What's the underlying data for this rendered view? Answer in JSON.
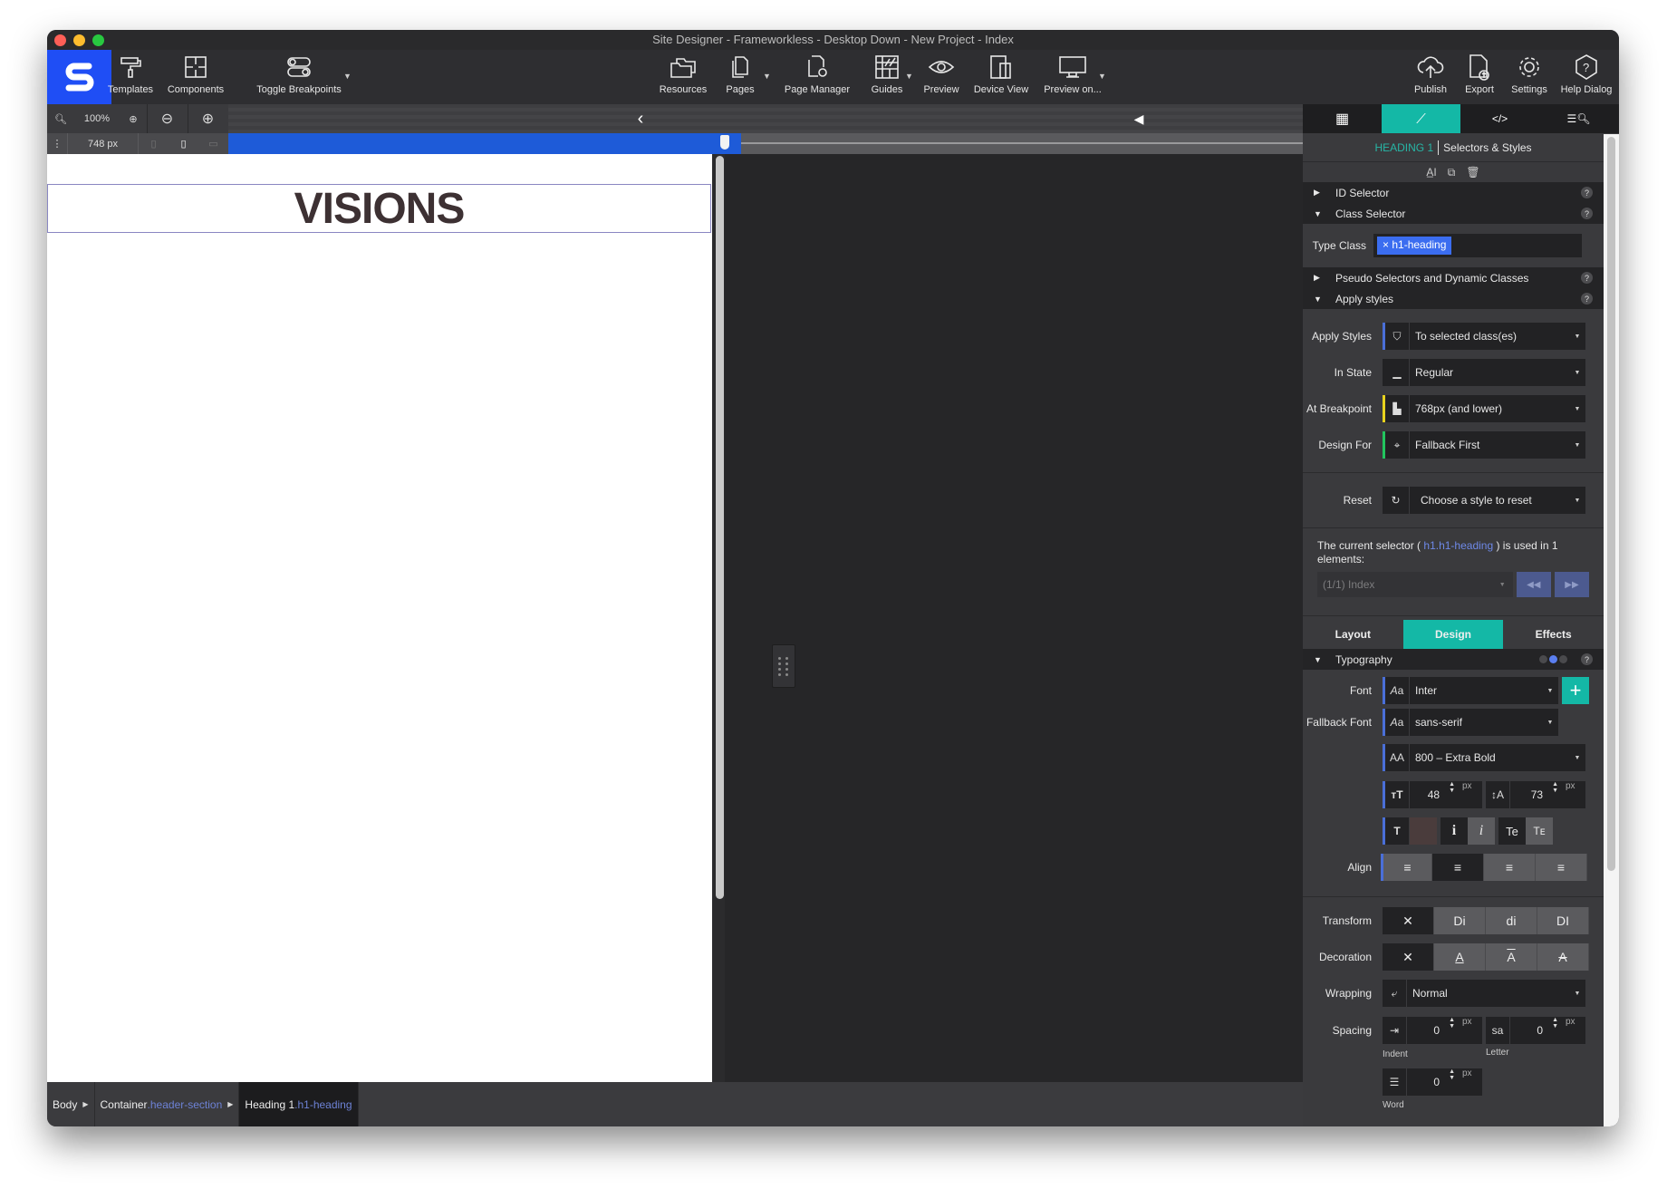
{
  "window": {
    "title": "Site Designer - Frameworkless - Desktop Down - New Project - Index"
  },
  "toolbar": {
    "left": [
      {
        "label": "Templates",
        "icon": "paint-roller-icon"
      },
      {
        "label": "Components",
        "icon": "puzzle-icon"
      },
      {
        "label": "Toggle Breakpoints",
        "icon": "toggle-icon"
      }
    ],
    "center": [
      {
        "label": "Resources",
        "icon": "folders-icon"
      },
      {
        "label": "Pages",
        "icon": "pages-icon"
      },
      {
        "label": "Page Manager",
        "icon": "page-manager-icon"
      },
      {
        "label": "Guides",
        "icon": "guides-icon"
      },
      {
        "label": "Preview",
        "icon": "eye-icon"
      },
      {
        "label": "Device View",
        "icon": "devices-icon"
      },
      {
        "label": "Preview on...",
        "icon": "monitor-icon"
      }
    ],
    "right": [
      {
        "label": "Publish",
        "icon": "cloud-upload-icon"
      },
      {
        "label": "Export",
        "icon": "export-icon"
      },
      {
        "label": "Settings",
        "icon": "gear-icon"
      },
      {
        "label": "Help Dialog",
        "icon": "help-icon"
      }
    ]
  },
  "canvas_controls": {
    "zoom": "100%",
    "width": "748 px",
    "breakpoint_position_pct": 68
  },
  "canvas": {
    "heading": "VISIONS",
    "heading_color": "#3d3133"
  },
  "breadcrumb": [
    {
      "name": "Body",
      "cls": ""
    },
    {
      "name": "Container",
      "cls": ".header-section"
    },
    {
      "name": "Heading 1",
      "cls": ".h1-heading"
    }
  ],
  "panel": {
    "element_type": "HEADING 1",
    "title": "Selectors & Styles",
    "sections": {
      "id_selector": "ID Selector",
      "class_selector": "Class Selector",
      "pseudo": "Pseudo Selectors and Dynamic Classes",
      "apply_styles": "Apply styles",
      "typography": "Typography"
    },
    "type_class_label": "Type Class",
    "type_class_tag": "h1-heading",
    "apply": {
      "apply_styles": {
        "label": "Apply Styles",
        "value": "To selected class(es)",
        "color": "#4a6fd8"
      },
      "in_state": {
        "label": "In State",
        "value": "Regular"
      },
      "at_breakpoint": {
        "label": "At Breakpoint",
        "value": "768px (and lower)",
        "color": "#e8d21e"
      },
      "design_for": {
        "label": "Design For",
        "value": "Fallback First",
        "color": "#22c55e"
      },
      "reset": {
        "label": "Reset",
        "value": "Choose a style to reset"
      }
    },
    "info": {
      "prefix": "The current selector (",
      "selector": "h1.h1-heading",
      "suffix": ") is used in 1 elements:",
      "page_select": "(1/1) Index"
    },
    "tabs": {
      "layout": "Layout",
      "design": "Design",
      "effects": "Effects"
    },
    "typography": {
      "font": {
        "label": "Font",
        "value": "Inter"
      },
      "fallback": {
        "label": "Fallback Font",
        "value": "sans-serif"
      },
      "weight": "800 – Extra Bold",
      "size": "48",
      "size_unit": "px",
      "line_height": "73",
      "line_unit": "px",
      "color": "#4a3c3c",
      "align_label": "Align",
      "transform_label": "Transform",
      "transform_options": [
        "Di",
        "di",
        "DI"
      ],
      "decoration_label": "Decoration",
      "wrapping_label": "Wrapping",
      "wrapping_value": "Normal",
      "spacing_label": "Spacing",
      "indent": "0",
      "indent_label": "Indent",
      "letter": "0",
      "letter_label": "Letter",
      "word": "0",
      "word_label": "Word",
      "unit": "px"
    }
  },
  "colors": {
    "accent": "#14b8a6",
    "brand": "#1f4ef5",
    "selection": "#1e5bd8"
  }
}
